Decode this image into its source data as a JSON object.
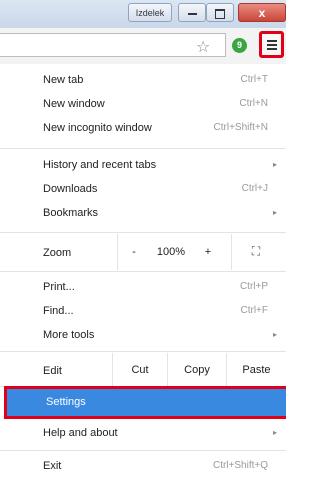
{
  "window": {
    "user_button": "Izdelek",
    "close_glyph": "x"
  },
  "toolbar": {
    "star_glyph": "☆",
    "extension_glyph": "9"
  },
  "icons": {
    "menu": "hamburger-icon",
    "bookmark": "star-icon",
    "extension": "evernote-icon"
  },
  "menu": {
    "new_tab": {
      "label": "New tab",
      "shortcut": "Ctrl+T"
    },
    "new_window": {
      "label": "New window",
      "shortcut": "Ctrl+N"
    },
    "incognito": {
      "label": "New incognito window",
      "shortcut": "Ctrl+Shift+N"
    },
    "history": {
      "label": "History and recent tabs"
    },
    "downloads": {
      "label": "Downloads",
      "shortcut": "Ctrl+J"
    },
    "bookmarks": {
      "label": "Bookmarks"
    },
    "zoom": {
      "label": "Zoom",
      "minus": "-",
      "value": "100%",
      "plus": "+",
      "fullscreen": "⛶"
    },
    "print": {
      "label": "Print...",
      "shortcut": "Ctrl+P"
    },
    "find": {
      "label": "Find...",
      "shortcut": "Ctrl+F"
    },
    "more_tools": {
      "label": "More tools"
    },
    "edit": {
      "label": "Edit",
      "cut": "Cut",
      "copy": "Copy",
      "paste": "Paste"
    },
    "settings": {
      "label": "Settings"
    },
    "help": {
      "label": "Help and about"
    },
    "exit": {
      "label": "Exit",
      "shortcut": "Ctrl+Shift+Q"
    },
    "arrow_glyph": "▸"
  },
  "colors": {
    "highlight": "#e0001a",
    "selected": "#3a89e0"
  }
}
